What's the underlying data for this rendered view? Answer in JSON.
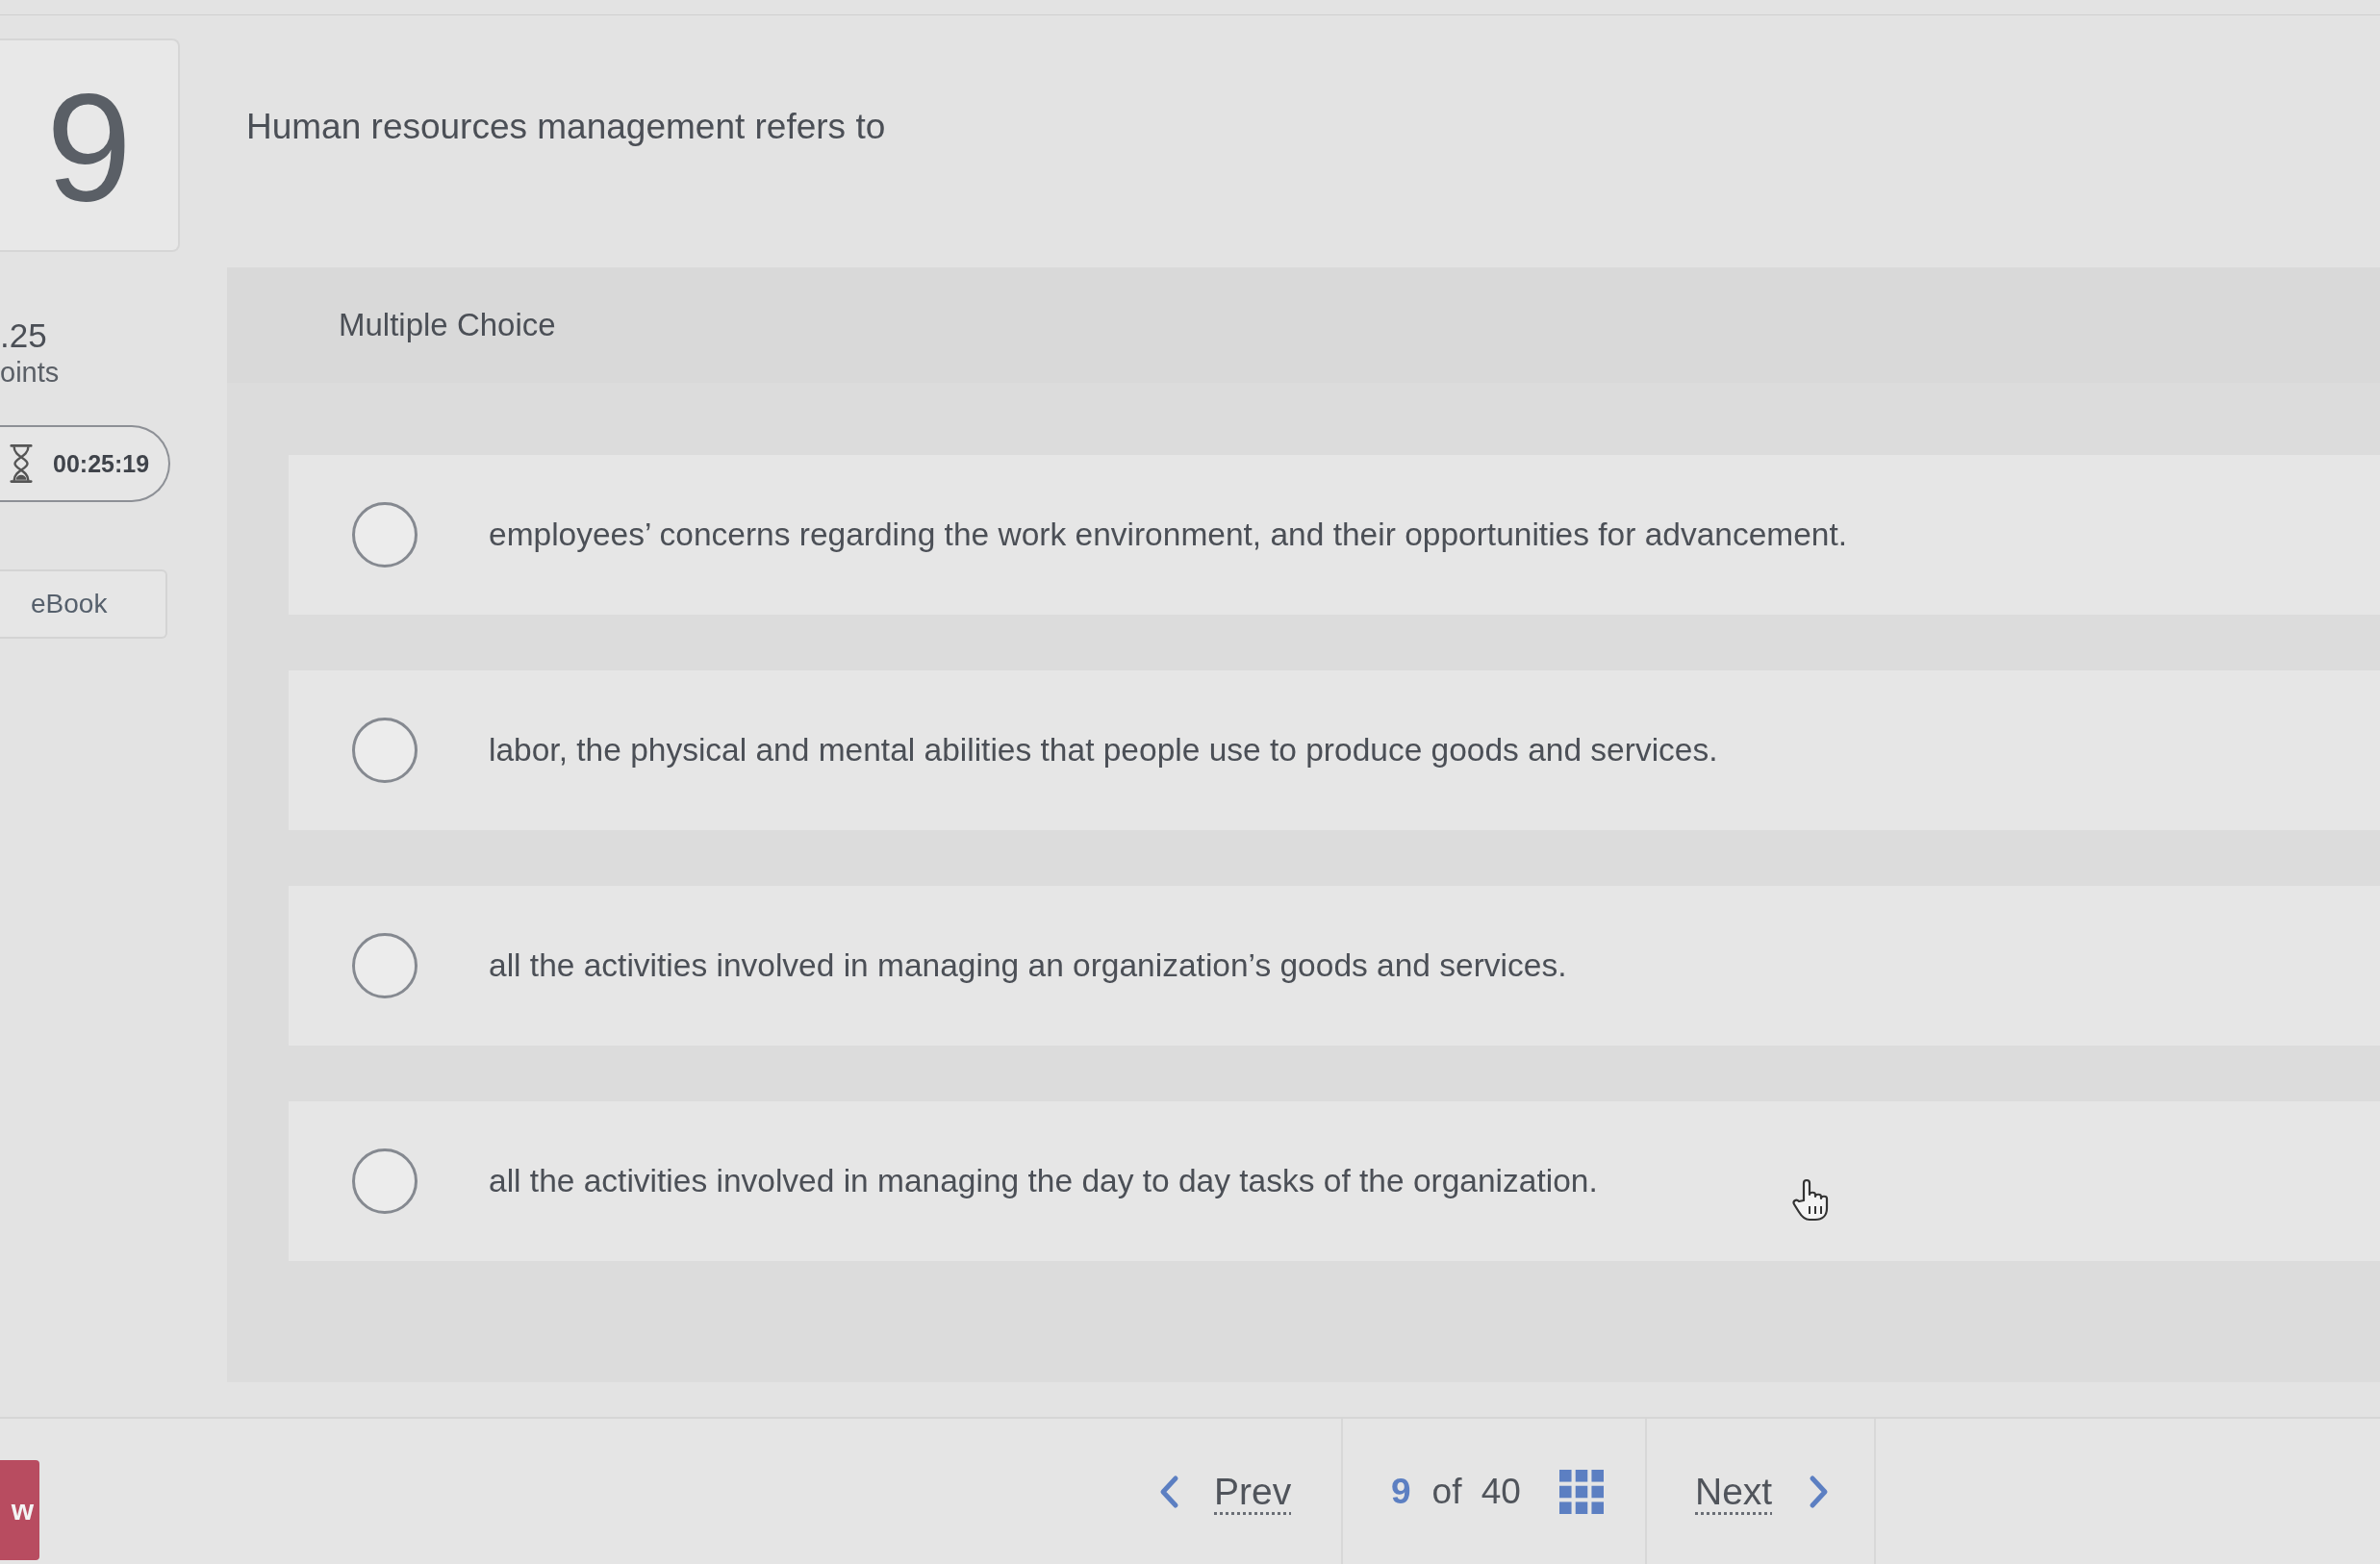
{
  "question": {
    "number": "9",
    "text": "Human resources management refers to"
  },
  "sidebar": {
    "points_value": ".25",
    "points_label": "oints",
    "timer": "00:25:19",
    "ebook": "eBook"
  },
  "answer_panel": {
    "type_label": "Multiple Choice",
    "options": [
      {
        "text": "employees’ concerns regarding the work environment, and their opportunities for advancement.",
        "selected": false
      },
      {
        "text": "labor, the physical and mental abilities that people use to produce goods and services.",
        "selected": false
      },
      {
        "text": "all the activities involved in managing an organization’s goods and services.",
        "selected": false
      },
      {
        "text": "all the activities involved in managing the day to day tasks of the organization.",
        "selected": false
      }
    ]
  },
  "footer": {
    "side_tab": "w",
    "prev": "Prev",
    "current": "9",
    "count_text": "of 40",
    "next": "Next"
  }
}
